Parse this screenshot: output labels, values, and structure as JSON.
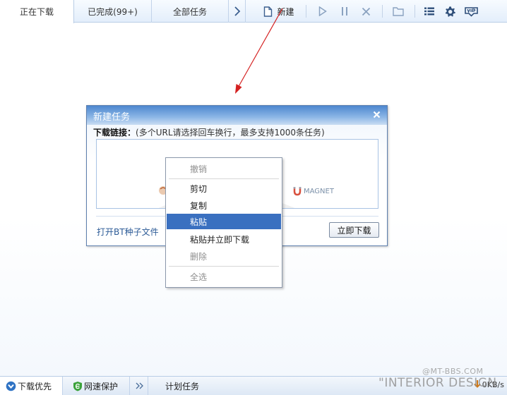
{
  "tabs": [
    {
      "label": "正在下载",
      "active": true
    },
    {
      "label": "已完成(99+)",
      "active": false
    },
    {
      "label": "全部任务",
      "active": false
    }
  ],
  "toolbar": {
    "new_label": "新建",
    "icons": [
      "more-tabs-chevron",
      "new-file-icon",
      "play-icon",
      "pause-icon",
      "delete-icon",
      "folder-icon",
      "list-icon",
      "gear-icon",
      "vip-icon"
    ]
  },
  "dialog": {
    "title": "新建任务",
    "label_bold": "下载链接：",
    "label_hint": "(多个URL请选择回车换行，最多支持1000条任务)",
    "magnet_text": "MAGNET",
    "bt_link": "打开BT种子文件",
    "download_button": "立即下载"
  },
  "context_menu": {
    "items": [
      {
        "label": "撤销",
        "state": "disabled"
      },
      {
        "label": "剪切",
        "state": "normal"
      },
      {
        "label": "复制",
        "state": "normal"
      },
      {
        "label": "粘贴",
        "state": "selected"
      },
      {
        "label": "粘贴并立即下载",
        "state": "normal"
      },
      {
        "label": "删除",
        "state": "disabled"
      },
      {
        "label": "全选",
        "state": "disabled"
      }
    ]
  },
  "statusbar": {
    "download_priority": "下载优先",
    "net_protect": "网速保护",
    "scheduled": "计划任务",
    "speed": "0KB/s"
  },
  "watermark": {
    "line1": "@MT-BBS.COM",
    "line2": "\"INTERIOR DESIGN"
  },
  "colors": {
    "accent": "#3a70c0",
    "title_bar": "#4d87cf",
    "annotation_arrow": "#d42020"
  }
}
